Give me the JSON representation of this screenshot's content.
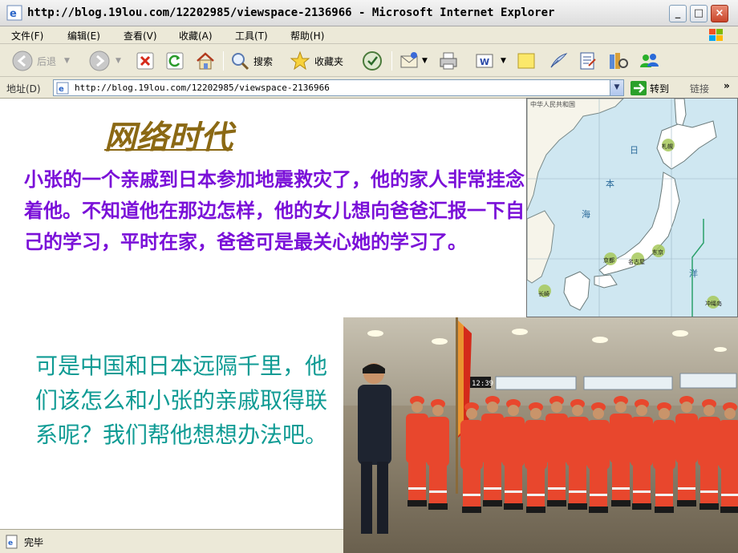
{
  "window": {
    "title": "http://blog.19lou.com/12202985/viewspace-2136966 - Microsoft Internet Explorer"
  },
  "menu": [
    "文件(F)",
    "编辑(E)",
    "查看(V)",
    "收藏(A)",
    "工具(T)",
    "帮助(H)"
  ],
  "toolbar": {
    "back_label": "后退",
    "search_label": "搜索",
    "favorites_label": "收藏夹"
  },
  "address": {
    "label": "地址(D)",
    "url": "http://blog.19lou.com/12202985/viewspace-2136966",
    "go_label": "转到",
    "links_label": "链接"
  },
  "slide": {
    "heading": "网络时代",
    "para1": "小张的一个亲戚到日本参加地震救灾了，他的家人非常挂念着他。不知道他在那边怎样，他的女儿想向爸爸汇报一下自己的学习，平时在家，爸爸可是最关心她的学习了。",
    "para2": "可是中国和日本远隔千里，他们该怎么和小张的亲戚取得联系呢？我们帮他想想办法吧。"
  },
  "map": {
    "header": "中华人民共和国",
    "sea_chars": [
      "日",
      "本",
      "海"
    ],
    "ocean_char": "洋",
    "cities": [
      "札幌",
      "东京",
      "京都",
      "名古屋",
      "长崎",
      "冲绳岛"
    ]
  },
  "photo": {
    "clock": "12:39"
  },
  "status": {
    "text": "完毕"
  },
  "colors": {
    "heading": "#8b6914",
    "para1": "#7a10d8",
    "para2": "#0f9b94",
    "map_sea": "#cfe7f1",
    "map_land": "#ffffff",
    "rescue_suit": "#e8472d"
  }
}
